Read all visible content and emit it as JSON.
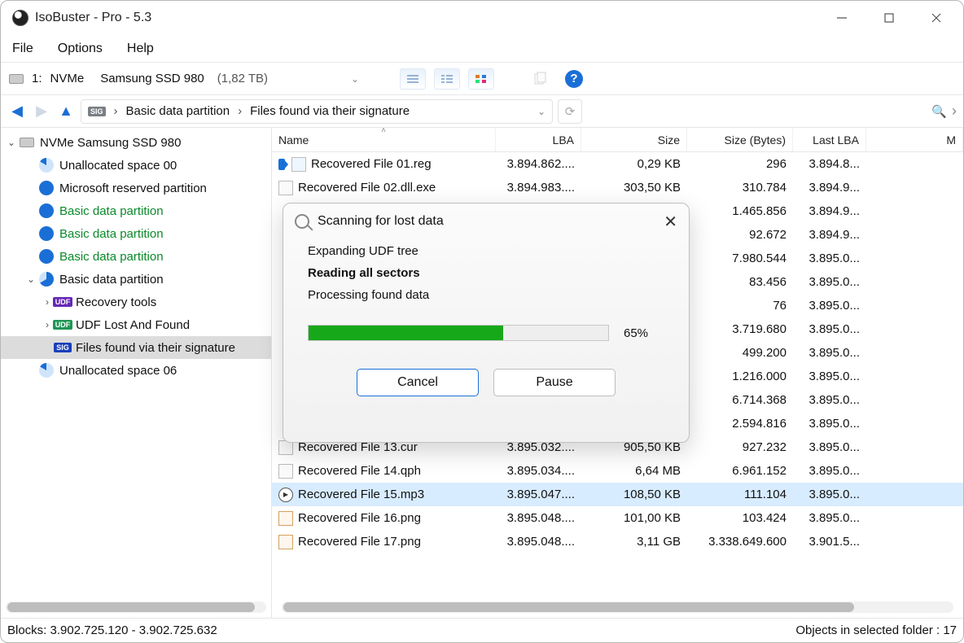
{
  "window": {
    "title": "IsoBuster - Pro - 5.3"
  },
  "menu": {
    "file": "File",
    "options": "Options",
    "help": "Help"
  },
  "drive": {
    "index": "1:",
    "bus": "NVMe",
    "model": "Samsung SSD 980",
    "size": "(1,82 TB)"
  },
  "crumb": {
    "part": "Basic data partition",
    "leaf": "Files found via their signature"
  },
  "tree": {
    "root": "NVMe Samsung SSD 980",
    "n1": "Unallocated space 00",
    "n2": "Microsoft reserved partition",
    "n3": "Basic data partition",
    "n4": "Basic data partition",
    "n5": "Basic data partition",
    "n6": "Basic data partition",
    "n7": "Recovery tools",
    "n8": "UDF Lost And Found",
    "n9": "Files found via their signature",
    "n10": "Unallocated space 06"
  },
  "cols": {
    "name": "Name",
    "lba": "LBA",
    "size": "Size",
    "bytes": "Size (Bytes)",
    "last": "Last LBA",
    "mod": "M"
  },
  "rows": [
    {
      "name": "Recovered File 01.reg",
      "lba": "3.894.862....",
      "size": "0,29 KB",
      "bytes": "296",
      "last": "3.894.8...",
      "icon": "reg",
      "tag": true
    },
    {
      "name": "Recovered File 02.dll.exe",
      "lba": "3.894.983....",
      "size": "303,50 KB",
      "bytes": "310.784",
      "last": "3.894.9...",
      "icon": "file"
    },
    {
      "name": "",
      "lba": "",
      "size": "",
      "bytes": "1.465.856",
      "last": "3.894.9...",
      "icon": ""
    },
    {
      "name": "",
      "lba": "",
      "size": "",
      "bytes": "92.672",
      "last": "3.894.9...",
      "icon": ""
    },
    {
      "name": "",
      "lba": "",
      "size": "",
      "bytes": "7.980.544",
      "last": "3.895.0...",
      "icon": ""
    },
    {
      "name": "",
      "lba": "",
      "size": "",
      "bytes": "83.456",
      "last": "3.895.0...",
      "icon": ""
    },
    {
      "name": "",
      "lba": "",
      "size": "",
      "bytes": "76",
      "last": "3.895.0...",
      "icon": ""
    },
    {
      "name": "",
      "lba": "",
      "size": "",
      "bytes": "3.719.680",
      "last": "3.895.0...",
      "icon": ""
    },
    {
      "name": "",
      "lba": "",
      "size": "",
      "bytes": "499.200",
      "last": "3.895.0...",
      "icon": ""
    },
    {
      "name": "",
      "lba": "",
      "size": "",
      "bytes": "1.216.000",
      "last": "3.895.0...",
      "icon": ""
    },
    {
      "name": "",
      "lba": "",
      "size": "",
      "bytes": "6.714.368",
      "last": "3.895.0...",
      "icon": ""
    },
    {
      "name": "",
      "lba": "",
      "size": "",
      "bytes": "2.594.816",
      "last": "3.895.0...",
      "icon": ""
    },
    {
      "name": "Recovered File 13.cur",
      "lba": "3.895.032....",
      "size": "905,50 KB",
      "bytes": "927.232",
      "last": "3.895.0...",
      "icon": "file"
    },
    {
      "name": "Recovered File 14.qph",
      "lba": "3.895.034....",
      "size": "6,64 MB",
      "bytes": "6.961.152",
      "last": "3.895.0...",
      "icon": "file"
    },
    {
      "name": "Recovered File 15.mp3",
      "lba": "3.895.047....",
      "size": "108,50 KB",
      "bytes": "111.104",
      "last": "3.895.0...",
      "icon": "mp3",
      "sel": true
    },
    {
      "name": "Recovered File 16.png",
      "lba": "3.895.048....",
      "size": "101,00 KB",
      "bytes": "103.424",
      "last": "3.895.0...",
      "icon": "png"
    },
    {
      "name": "Recovered File 17.png",
      "lba": "3.895.048....",
      "size": "3,11 GB",
      "bytes": "3.338.649.600",
      "last": "3.901.5...",
      "icon": "png"
    }
  ],
  "status": {
    "left": "Blocks: 3.902.725.120 - 3.902.725.632",
    "right": "Objects in selected folder : 17"
  },
  "dialog": {
    "title": "Scanning for lost data",
    "l1": "Expanding UDF tree",
    "l2": "Reading all sectors",
    "l3": "Processing found data",
    "pct": "65%",
    "cancel": "Cancel",
    "pause": "Pause"
  }
}
